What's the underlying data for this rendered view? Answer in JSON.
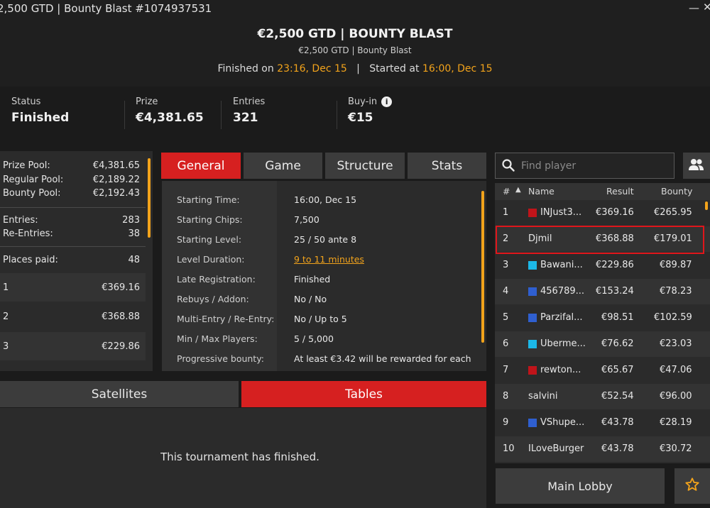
{
  "window": {
    "title": "2,500 GTD | Bounty Blast #1074937531",
    "minimize_glyph": "—",
    "close_glyph": "✕"
  },
  "header": {
    "title": "€2,500 GTD | BOUNTY BLAST",
    "subtitle": "€2,500 GTD | Bounty Blast",
    "finished_label": "Finished on",
    "finished_value": "23:16, Dec 15",
    "divider": "|",
    "started_label": "Started at",
    "started_value": "16:00, Dec 15"
  },
  "summary": {
    "status_label": "Status",
    "status_value": "Finished",
    "prize_label": "Prize",
    "prize_value": "€4,381.65",
    "entries_label": "Entries",
    "entries_value": "321",
    "buyin_label": "Buy-in",
    "buyin_value": "€15"
  },
  "left_panel": {
    "prize_pool_label": "Prize Pool:",
    "prize_pool_value": "€4,381.65",
    "regular_pool_label": "Regular Pool:",
    "regular_pool_value": "€2,189.22",
    "bounty_pool_label": "Bounty Pool:",
    "bounty_pool_value": "€2,192.43",
    "entries_label": "Entries:",
    "entries_value": "283",
    "reentries_label": "Re-Entries:",
    "reentries_value": "38",
    "places_paid_label": "Places paid:",
    "places_paid_value": "48",
    "payouts": [
      {
        "place": "1",
        "amount": "€369.16"
      },
      {
        "place": "2",
        "amount": "€368.88"
      },
      {
        "place": "3",
        "amount": "€229.86"
      }
    ]
  },
  "tabs": [
    {
      "label": "General",
      "active": true
    },
    {
      "label": "Game",
      "active": false
    },
    {
      "label": "Structure",
      "active": false
    },
    {
      "label": "Stats",
      "active": false
    }
  ],
  "general": [
    {
      "label": "Starting Time:",
      "value": "16:00, Dec 15"
    },
    {
      "label": "Starting Chips:",
      "value": "7,500"
    },
    {
      "label": "Starting Level:",
      "value": "25 / 50 ante 8"
    },
    {
      "label": "Level Duration:",
      "value": "9 to 11 minutes"
    },
    {
      "label": "Late Registration:",
      "value": "Finished"
    },
    {
      "label": "Rebuys / Addon:",
      "value": "No / No"
    },
    {
      "label": "Multi-Entry / Re-Entry:",
      "value": "No / Up to 5"
    },
    {
      "label": "Min / Max Players:",
      "value": "5 / 5,000"
    },
    {
      "label": "Progressive bounty:",
      "value": "At least €3.42 will be rewarded for each"
    }
  ],
  "bottom_tabs": [
    {
      "label": "Satellites",
      "active": false
    },
    {
      "label": "Tables",
      "active": true
    }
  ],
  "bottom_message": "This tournament has finished.",
  "search": {
    "placeholder": "Find player"
  },
  "players_header": {
    "num": "#",
    "sort_glyph": "▲",
    "name": "Name",
    "result": "Result",
    "bounty": "Bounty"
  },
  "players": [
    {
      "rank": "1",
      "name": "INJust3...",
      "result": "€369.16",
      "bounty": "€265.95",
      "flag": "#c0141a"
    },
    {
      "rank": "2",
      "name": "Djmil",
      "result": "€368.88",
      "bounty": "€179.01",
      "flag": ""
    },
    {
      "rank": "3",
      "name": "Bawani...",
      "result": "€229.86",
      "bounty": "€89.87",
      "flag": "#1cb8e8"
    },
    {
      "rank": "4",
      "name": "456789...",
      "result": "€153.24",
      "bounty": "€78.23",
      "flag": "#2f5fd0"
    },
    {
      "rank": "5",
      "name": "Parzifal...",
      "result": "€98.51",
      "bounty": "€102.59",
      "flag": "#2f5fd0"
    },
    {
      "rank": "6",
      "name": "Uberme...",
      "result": "€76.62",
      "bounty": "€23.03",
      "flag": "#1cb8e8"
    },
    {
      "rank": "7",
      "name": "rewton...",
      "result": "€65.67",
      "bounty": "€47.06",
      "flag": "#c0141a"
    },
    {
      "rank": "8",
      "name": "salvini",
      "result": "€52.54",
      "bounty": "€96.00",
      "flag": ""
    },
    {
      "rank": "9",
      "name": "VShupe...",
      "result": "€43.78",
      "bounty": "€28.19",
      "flag": "#2f5fd0"
    },
    {
      "rank": "10",
      "name": "ILoveBurger",
      "result": "€43.78",
      "bounty": "€30.72",
      "flag": ""
    }
  ],
  "main_lobby_label": "Main Lobby",
  "colors": {
    "accent_red": "#d62020",
    "accent_orange": "#f2a31b",
    "highlight_border": "#e0161b"
  }
}
